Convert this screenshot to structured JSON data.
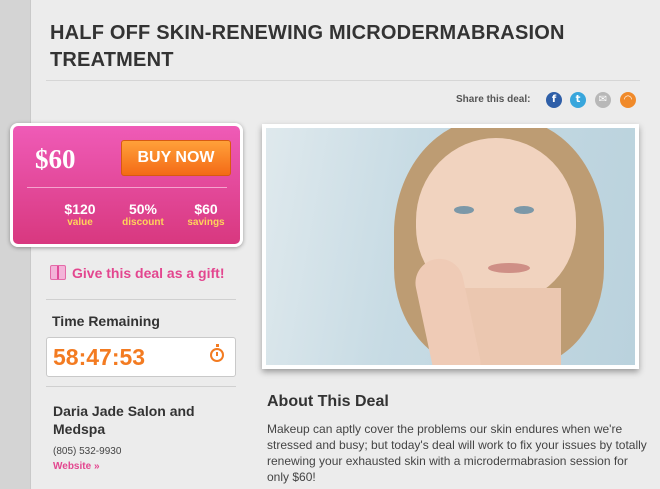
{
  "deal": {
    "title": "HALF OFF SKIN-RENEWING MICRODERMABRASION TREATMENT",
    "share_label": "Share this deal:",
    "share_icons": [
      "facebook-icon",
      "twitter-icon",
      "email-icon",
      "rss-icon"
    ]
  },
  "pricing": {
    "price": "$60",
    "buy_label": "BUY NOW",
    "stats": [
      {
        "value": "$120",
        "label": "value"
      },
      {
        "value": "50%",
        "label": "discount"
      },
      {
        "value": "$60",
        "label": "savings"
      }
    ]
  },
  "gift": {
    "label": "Give this deal as a gift!"
  },
  "timer": {
    "label": "Time Remaining",
    "value": "58:47:53"
  },
  "merchant": {
    "name": "Daria Jade Salon and Medspa",
    "phone": "(805) 532-9930",
    "website": "Website »"
  },
  "about": {
    "title": "About This Deal",
    "text": "Makeup can aptly cover the problems our skin endures when we're stressed and busy; but today's deal will work to fix your issues by totally renewing your exhausted skin with a microdermabrasion session for only $60!"
  },
  "colors": {
    "accent": "#e3468f",
    "buy_button": "#f46a16",
    "timer": "#f37b21"
  }
}
